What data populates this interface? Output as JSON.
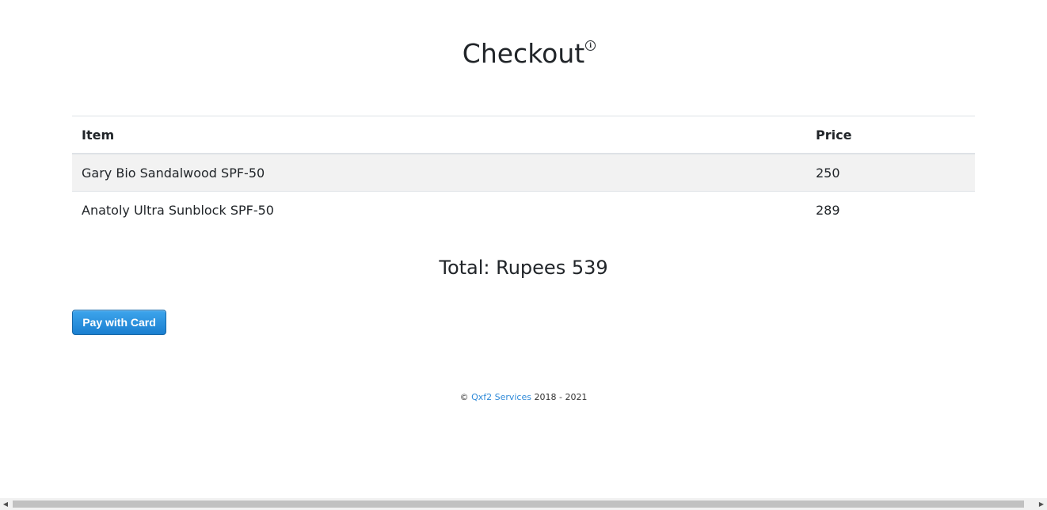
{
  "header": {
    "title": "Checkout",
    "info_icon": "info-circle-icon"
  },
  "cart_table": {
    "columns": [
      "Item",
      "Price"
    ],
    "rows": [
      {
        "item": "Gary Bio Sandalwood SPF-50",
        "price": "250"
      },
      {
        "item": "Anatoly Ultra Sunblock SPF-50",
        "price": "289"
      }
    ]
  },
  "total": {
    "label": "Total: Rupees 539"
  },
  "payment": {
    "button_label": "Pay with Card"
  },
  "footer": {
    "copyright_symbol": "©",
    "company_link": "Qxf2 Services",
    "years": "2018 - 2021"
  },
  "colors": {
    "button": "#1a7fd0",
    "link": "#2f8ad8",
    "stripe": "#f2f2f2"
  }
}
